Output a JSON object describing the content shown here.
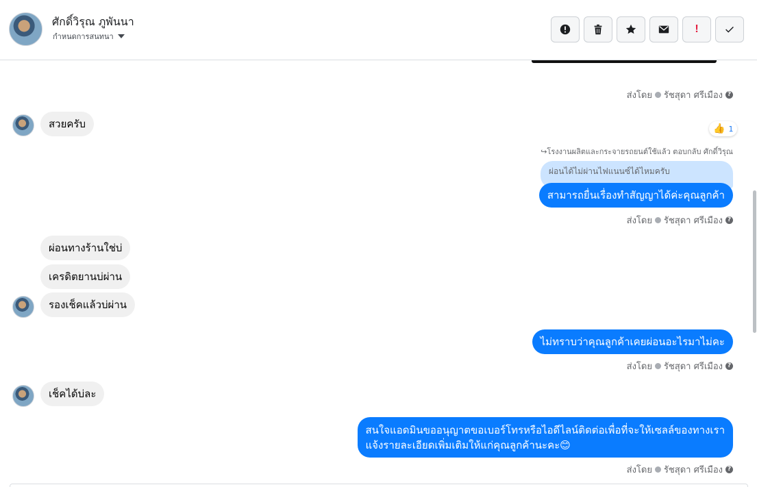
{
  "header": {
    "contact_name": "ศักดิ์วิรุณ ภูพันนา",
    "assign_label": "กำหนดการสนทนา",
    "toolbar": [
      {
        "name": "spam-button",
        "icon": "alert-circle-icon"
      },
      {
        "name": "delete-button",
        "icon": "trash-icon"
      },
      {
        "name": "star-button",
        "icon": "star-icon"
      },
      {
        "name": "mark-unread-button",
        "icon": "envelope-icon"
      },
      {
        "name": "follow-up-button",
        "icon": "exclamation-icon",
        "text": "!"
      },
      {
        "name": "mark-done-button",
        "icon": "check-icon"
      }
    ]
  },
  "thread": {
    "reaction": {
      "emoji": "👍",
      "count": "1"
    },
    "sent_by": {
      "prefix": "ส่งโดย",
      "agent": "รัชสุดา ศรีเมือง",
      "help": "?"
    },
    "reply_meta": "↪โรงงานผลิตและกระจายรถยนต์ใช้แล้ว ตอบกลับ ศักดิ์วิรุณ",
    "quoted_text": "ผ่อนได้ไม่ผ่านไฟแนนซ์ได้ไหมครับ",
    "messages": {
      "m1": "สวยครับ",
      "m2": "สามารถยื่นเรื่องทำสัญญาได้ค่ะคุณลูกค้า",
      "m3": "ผ่อนทางร้านใช่บ่",
      "m4": "เครดิตยานบ่ผ่าน",
      "m5": "รองเช็คแล้วบ่ผ่าน",
      "m6": "ไม่ทราบว่าคุณลูกค้าเคยผ่อนอะไรมาไม่คะ",
      "m7": "เช็คได้บ่ละ",
      "m8_line1": "สนใจแอดมินขออนุญาตขอเบอร์โทรหรือไอดีไลน์ติดต่อเพื่อที่จะให้เซลล์ของทางเรา",
      "m8_line2": "แจ้งรายละเอียดเพิ่มเติมให้แก่คุณลูกค้านะคะ😊"
    }
  },
  "colors": {
    "outgoing_bubble": "#0a7cff",
    "incoming_bubble": "#f0f0f0",
    "quoted_bubble": "#cce4ff",
    "follow_up_icon": "#e41e3f"
  }
}
